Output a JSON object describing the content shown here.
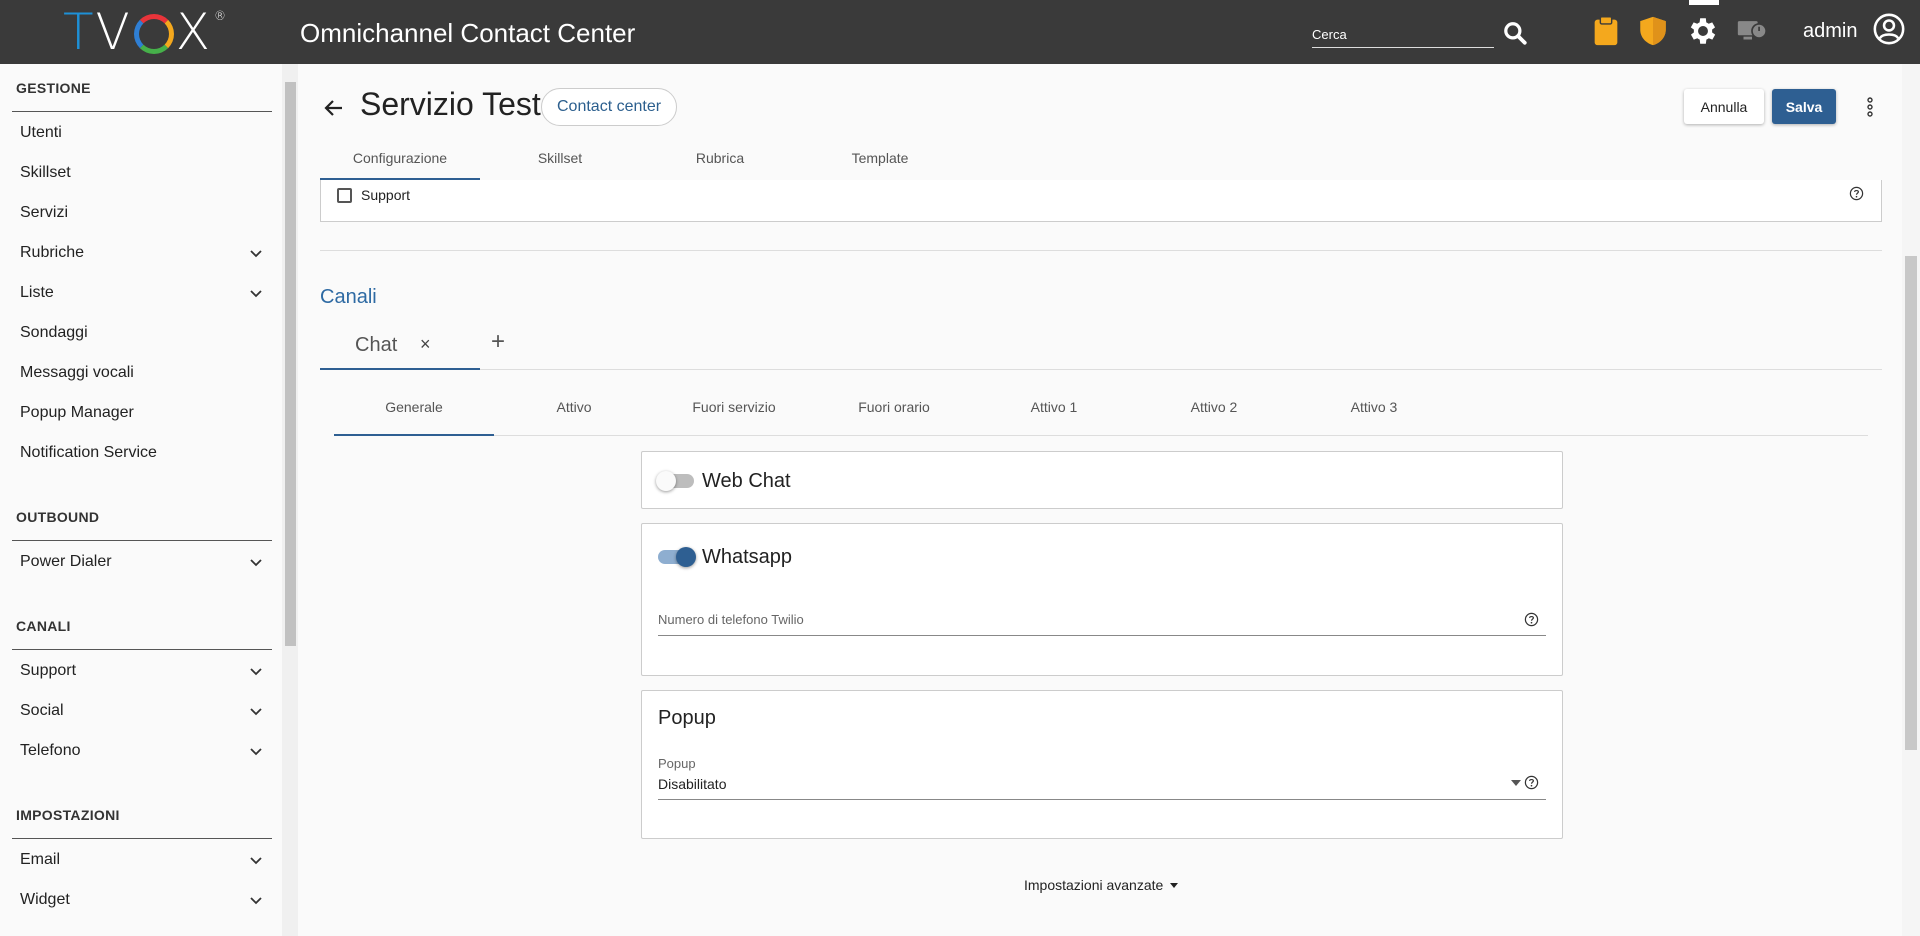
{
  "header": {
    "logo_text": "TVOX",
    "app_title": "Omnichannel Contact Center",
    "search_placeholder": "Cerca",
    "user": "admin",
    "icons": [
      "search-icon",
      "clipboard-icon",
      "shield-icon",
      "gear-icon",
      "monitor-timer-icon",
      "account-circle-icon"
    ],
    "colors": {
      "bar": "#3a3a3a",
      "clipboard": "#f4a81d",
      "shield": "#f4a81d"
    }
  },
  "sidebar": {
    "sections": [
      {
        "title": "GESTIONE",
        "items": [
          {
            "label": "Utenti",
            "chevron": false
          },
          {
            "label": "Skillset",
            "chevron": false
          },
          {
            "label": "Servizi",
            "chevron": false
          },
          {
            "label": "Rubriche",
            "chevron": true
          },
          {
            "label": "Liste",
            "chevron": true
          },
          {
            "label": "Sondaggi",
            "chevron": false
          },
          {
            "label": "Messaggi vocali",
            "chevron": false
          },
          {
            "label": "Popup Manager",
            "chevron": false
          },
          {
            "label": "Notification Service",
            "chevron": false
          }
        ]
      },
      {
        "title": "OUTBOUND",
        "items": [
          {
            "label": "Power Dialer",
            "chevron": true
          }
        ]
      },
      {
        "title": "CANALI",
        "items": [
          {
            "label": "Support",
            "chevron": true
          },
          {
            "label": "Social",
            "chevron": true
          },
          {
            "label": "Telefono",
            "chevron": true
          }
        ]
      },
      {
        "title": "IMPOSTAZIONI",
        "items": [
          {
            "label": "Email",
            "chevron": true
          },
          {
            "label": "Widget",
            "chevron": true
          }
        ]
      }
    ]
  },
  "page": {
    "title": "Servizio Test",
    "chip": "Contact center",
    "cancel_label": "Annulla",
    "save_label": "Salva",
    "tabs": [
      "Configurazione",
      "Skillset",
      "Rubrica",
      "Template"
    ],
    "active_tab": "Configurazione",
    "support_checkbox_label": "Support",
    "support_checked": false
  },
  "channels": {
    "title": "Canali",
    "tabs": [
      {
        "label": "Chat",
        "close": "×"
      }
    ],
    "add_label": "+",
    "sub_tabs": [
      "Generale",
      "Attivo",
      "Fuori servizio",
      "Fuori orario",
      "Attivo 1",
      "Attivo 2",
      "Attivo 3"
    ],
    "active_sub_tab": "Generale"
  },
  "cards": {
    "webchat": {
      "title": "Web Chat",
      "enabled": false
    },
    "whatsapp": {
      "title": "Whatsapp",
      "enabled": true,
      "field_placeholder": "Numero di telefono Twilio",
      "field_value": ""
    },
    "popup": {
      "title": "Popup",
      "field_label": "Popup",
      "field_value": "Disabilitato"
    }
  },
  "advanced_label": "Impostazioni avanzate",
  "colors": {
    "accent": "#2e5f92",
    "link": "#2e6aa3"
  }
}
